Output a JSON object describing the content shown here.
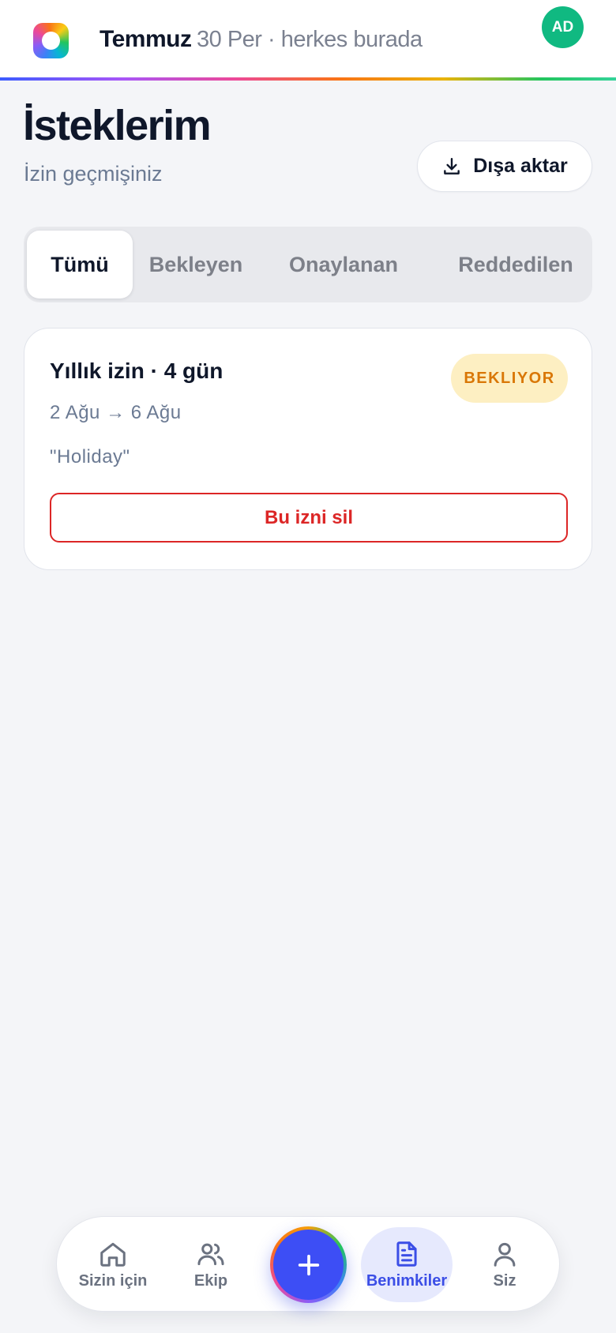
{
  "header": {
    "brand": "Temmuz",
    "subtitle": "30 Per · herkes burada",
    "avatar_initials": "AD",
    "avatar_color": "#10b981"
  },
  "page": {
    "title": "İsteklerim",
    "subtitle": "İzin geçmişiniz",
    "export_label": "Dışa aktar",
    "export_icon": "download-icon"
  },
  "tabs": [
    {
      "label": "Tümü",
      "active": true
    },
    {
      "label": "Bekleyen",
      "active": false
    },
    {
      "label": "Onaylanan",
      "active": false
    },
    {
      "label": "Reddedilen",
      "active": false
    }
  ],
  "requests": [
    {
      "title": "Yıllık izin · 4 gün",
      "status": "BEKLIYOR",
      "dates": "2 Ağu → 6 Ağu",
      "note": "\"Holiday\"",
      "delete_label": "Bu izni sil"
    }
  ],
  "bottom_nav": {
    "items": [
      {
        "label": "Sizin için",
        "icon": "home-icon",
        "active": false
      },
      {
        "label": "Ekip",
        "icon": "users-icon",
        "active": false
      },
      {
        "label": "Benimkiler",
        "icon": "document-icon",
        "active": true
      },
      {
        "label": "Siz",
        "icon": "user-icon",
        "active": false
      }
    ],
    "fab_icon": "plus-icon"
  },
  "colors": {
    "accent": "#3d4ef5",
    "pending_badge_bg": "#fdefc2",
    "pending_badge_text": "#d97706",
    "danger": "#dc2626"
  }
}
